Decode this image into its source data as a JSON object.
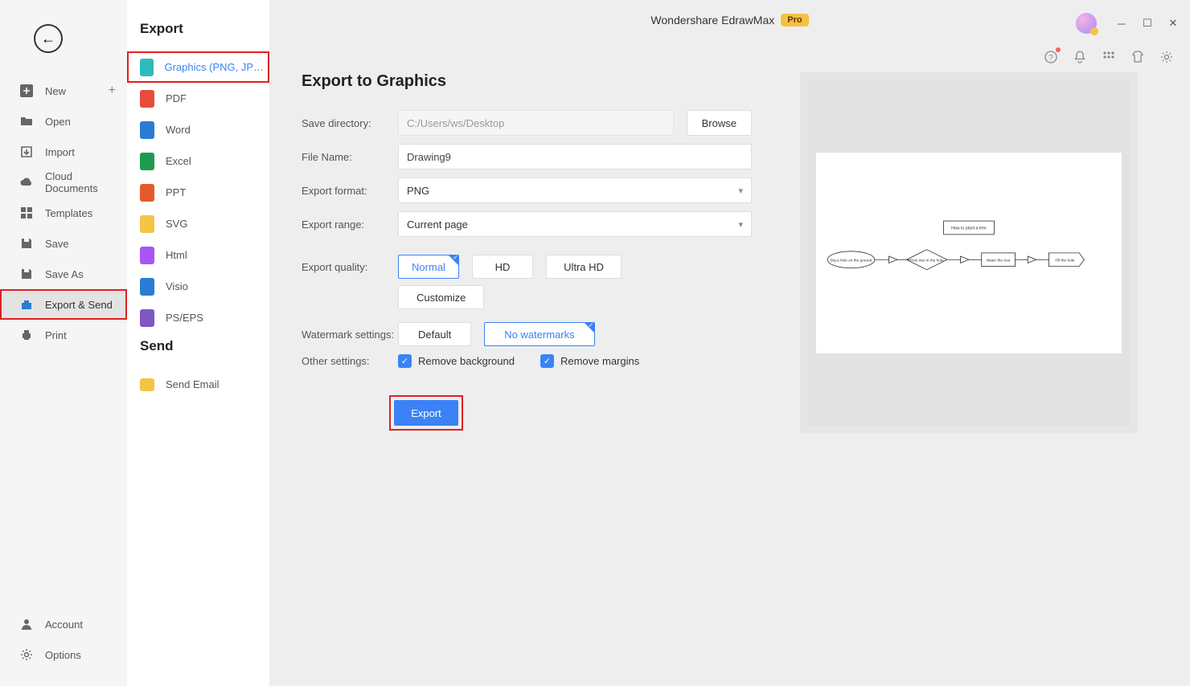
{
  "title": "Wondershare EdrawMax",
  "pro_badge": "Pro",
  "nav": {
    "new": "New",
    "open": "Open",
    "import": "Import",
    "cloud": "Cloud Documents",
    "templates": "Templates",
    "save": "Save",
    "save_as": "Save As",
    "export_send": "Export & Send",
    "print": "Print",
    "account": "Account",
    "options": "Options"
  },
  "export_section_title": "Export",
  "send_section_title": "Send",
  "export_types": {
    "graphics": "Graphics (PNG, JPG e...",
    "pdf": "PDF",
    "word": "Word",
    "excel": "Excel",
    "ppt": "PPT",
    "svg": "SVG",
    "html": "Html",
    "visio": "Visio",
    "pseps": "PS/EPS"
  },
  "send_types": {
    "email": "Send Email"
  },
  "page_heading": "Export to Graphics",
  "labels": {
    "save_dir": "Save directory:",
    "file_name": "File Name:",
    "export_format": "Export format:",
    "export_range": "Export range:",
    "export_quality": "Export quality:",
    "watermark": "Watermark settings:",
    "other": "Other settings:"
  },
  "fields": {
    "save_dir": "C:/Users/ws/Desktop",
    "file_name": "Drawing9",
    "format": "PNG",
    "range": "Current page"
  },
  "quality": {
    "normal": "Normal",
    "hd": "HD",
    "ultra": "Ultra HD",
    "customize": "Customize"
  },
  "watermark": {
    "default": "Default",
    "none": "No watermarks"
  },
  "other": {
    "remove_bg": "Remove background",
    "remove_margins": "Remove margins"
  },
  "browse_btn": "Browse",
  "export_btn": "Export",
  "preview": {
    "title_box": "How to plant a tree",
    "step1": "Dig a hole on the ground",
    "step2": "Puts tree in the hole",
    "step3": "Water the tree",
    "step4": "Fill the hole"
  },
  "colors": {
    "graphics_icon": "#2fbabd",
    "pdf_icon": "#e74c3c",
    "word_icon": "#2b7cd3",
    "excel_icon": "#1d9c4e",
    "ppt_icon": "#e55a2b",
    "svg_icon": "#f4c542",
    "html_icon": "#a855f7",
    "visio_icon": "#2b7cd3",
    "pseps_icon": "#7e57c2",
    "email_icon": "#f4c542"
  }
}
